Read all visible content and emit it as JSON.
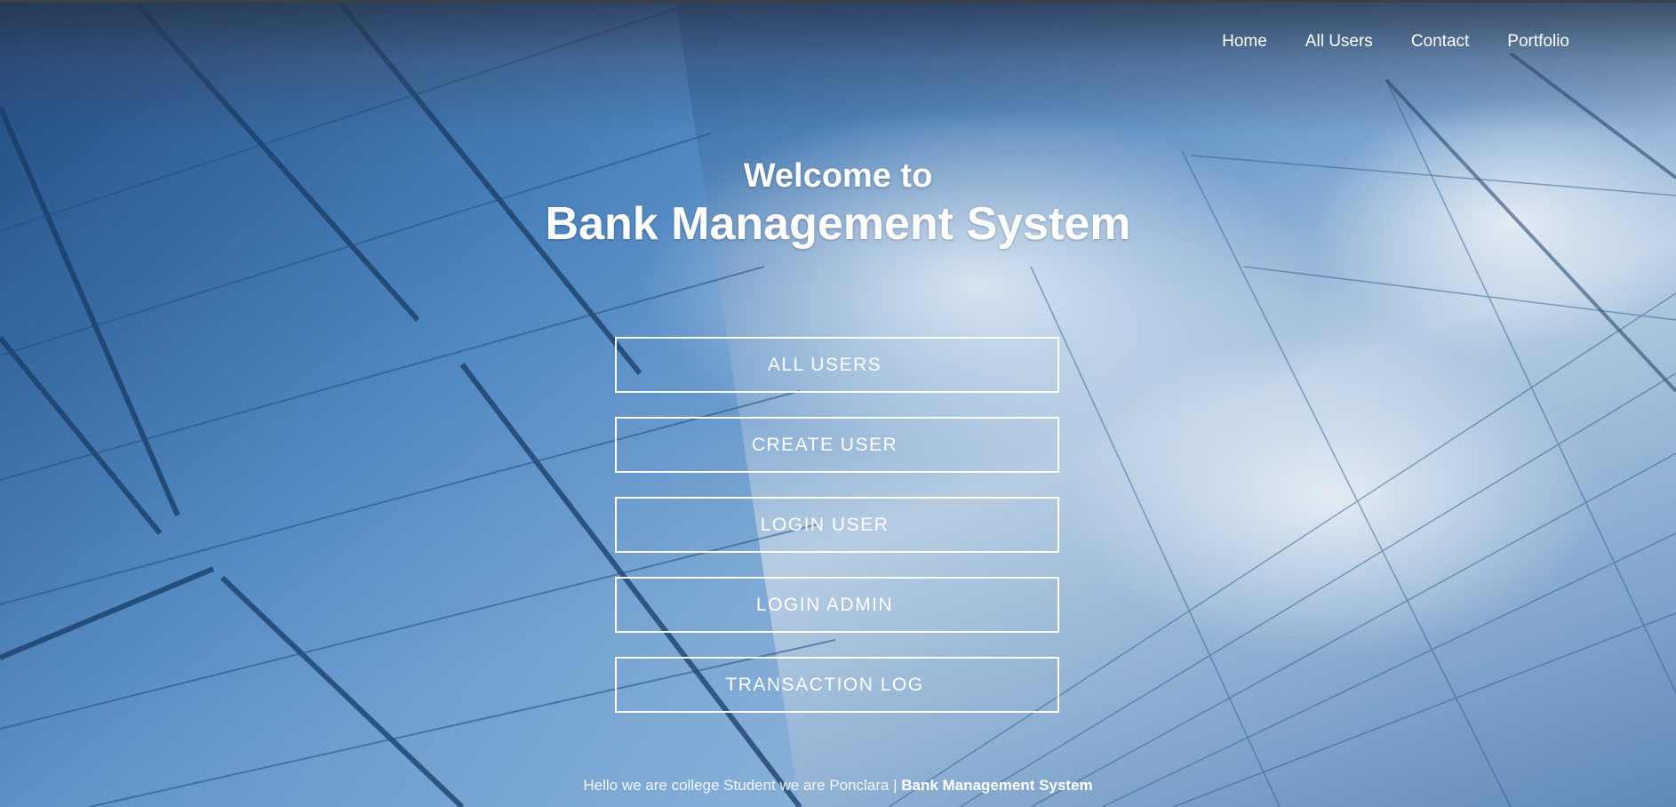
{
  "nav": {
    "items": [
      {
        "label": "Home"
      },
      {
        "label": "All Users"
      },
      {
        "label": "Contact"
      },
      {
        "label": "Portfolio"
      }
    ]
  },
  "hero": {
    "welcome": "Welcome to",
    "title": "Bank Management System"
  },
  "actions": [
    {
      "label": "ALL USERS"
    },
    {
      "label": "CREATE USER"
    },
    {
      "label": "LOGIN USER"
    },
    {
      "label": "LOGIN ADMIN"
    },
    {
      "label": "TRANSACTION LOG"
    }
  ],
  "footer": {
    "text": "Hello we are college Student we are Ponclara | ",
    "brand": "Bank Management System"
  },
  "colors": {
    "text": "#ffffff",
    "sky_light": "#b7cde3",
    "glass_dark": "#234a7a"
  }
}
